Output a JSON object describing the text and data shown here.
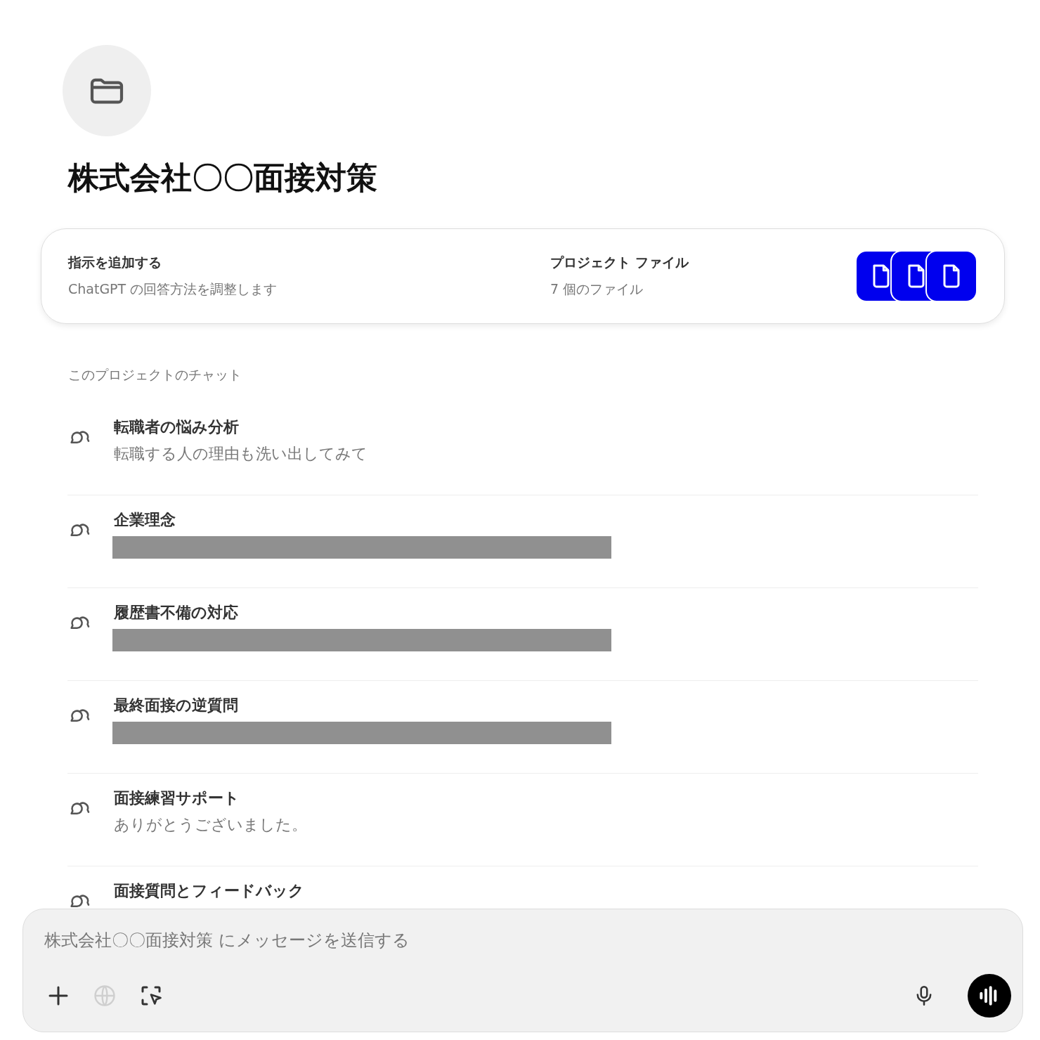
{
  "project": {
    "title": "株式会社〇〇面接対策"
  },
  "instructions": {
    "title": "指示を追加する",
    "subtitle": "ChatGPT の回答方法を調整します"
  },
  "files": {
    "title": "プロジェクト ファイル",
    "count": "7 個のファイル"
  },
  "chats_heading": "このプロジェクトのチャット",
  "chats": [
    {
      "title": "転職者の悩み分析",
      "redacted": false,
      "subtitle": "転職する人の理由も洗い出してみて"
    },
    {
      "title": "企業理念",
      "redacted": true
    },
    {
      "title": "履歴書不備の対応",
      "redacted": true
    },
    {
      "title": "最終面接の逆質問",
      "redacted": true
    },
    {
      "title": "面接練習サポート",
      "redacted": false,
      "subtitle": "ありがとうございました。"
    },
    {
      "title": "面接質問とフィードバック",
      "redacted": false
    }
  ],
  "composer": {
    "placeholder": "株式会社〇〇面接対策 にメッセージを送信する",
    "tools": [
      {
        "kind": "plus",
        "disabled": false
      },
      {
        "kind": "globe",
        "disabled": true
      },
      {
        "kind": "select",
        "disabled": false
      }
    ]
  }
}
